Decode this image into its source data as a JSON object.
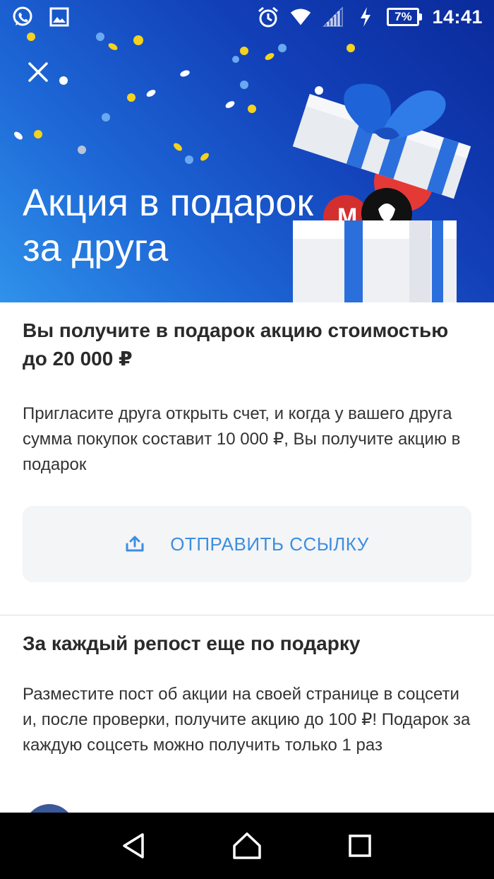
{
  "status_bar": {
    "time": "14:41",
    "battery_percent": "7%",
    "icons": [
      "whatsapp-icon",
      "image-icon",
      "alarm-icon",
      "wifi-icon",
      "signal-icon",
      "charging-icon"
    ]
  },
  "hero": {
    "title": "Акция в подарок\nза друга",
    "close_icon": "close-icon",
    "gradient_colors": [
      "#0a2a9a",
      "#2f92ea"
    ]
  },
  "section1": {
    "title": "Вы получите в подарок акцию стоимостью до 20 000 ₽",
    "text": "Пригласите друга открыть счет, и когда у вашего друга сумма покупок составит 10 000 ₽, Вы получите акцию в подарок",
    "button_label": "ОТПРАВИТЬ ССЫЛКУ",
    "button_icon": "share-upload-icon"
  },
  "section2": {
    "title": "За каждый репост еще по подарку",
    "text": "Разместите пост об акции на своей странице в соцсети и, после проверки, получите акцию до 100 ₽! Подарок за каждую соцсеть можно получить только 1 раз"
  },
  "colors": {
    "accent": "#3d8ee0",
    "button_bg": "#f4f5f7",
    "nav_bg": "#000000"
  },
  "nav_bar": {
    "buttons": [
      "back-icon",
      "home-icon",
      "recents-icon"
    ]
  }
}
